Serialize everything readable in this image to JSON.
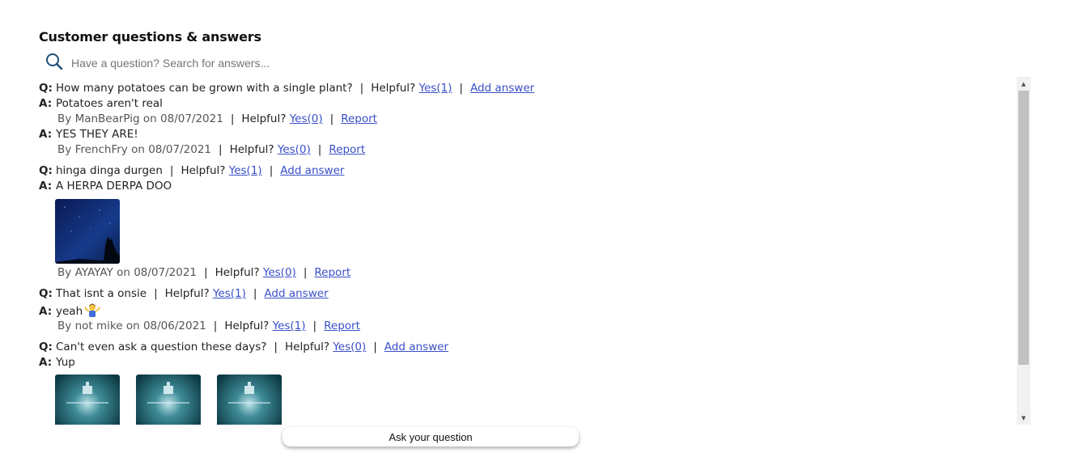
{
  "section": {
    "title": "Customer questions & answers"
  },
  "search": {
    "placeholder": "Have a question? Search for answers..."
  },
  "labels": {
    "q": "Q:",
    "a": "A:",
    "helpful": "Helpful?",
    "sep": "|",
    "by": "By",
    "on": "on"
  },
  "questions": [
    {
      "text": "How many potatoes can be grown with a single plant?",
      "yes": "Yes(1)",
      "add_answer": "Add answer",
      "answers": [
        {
          "text": "Potatoes aren't real",
          "author": "ManBearPig",
          "date": "08/07/2021",
          "yes": "Yes(0)",
          "report": "Report"
        },
        {
          "text": "YES THEY ARE!",
          "author": "FrenchFry",
          "date": "08/07/2021",
          "yes": "Yes(0)",
          "report": "Report"
        }
      ]
    },
    {
      "text": "hinga dinga durgen",
      "yes": "Yes(1)",
      "add_answer": "Add answer",
      "answers": [
        {
          "text": "A HERPA DERPA DOO",
          "author": "AYAYAY",
          "date": "08/07/2021",
          "yes": "Yes(0)",
          "report": "Report"
        }
      ]
    },
    {
      "text": "That isnt a onsie",
      "yes": "Yes(1)",
      "add_answer": "Add answer",
      "answers": [
        {
          "text": "yeah",
          "emoji": "person-shrugging-emoji",
          "author": "not mike",
          "date": "08/06/2021",
          "yes": "Yes(1)",
          "report": "Report"
        }
      ]
    },
    {
      "text": "Can't even ask a question these days?",
      "yes": "Yes(0)",
      "add_answer": "Add answer",
      "answers": [
        {
          "text": "Yup"
        }
      ]
    }
  ],
  "scrollbar": {
    "up": "▲",
    "down": "▼"
  },
  "ask_button": {
    "label": "Ask your question"
  },
  "colors": {
    "link": "#3a50c8",
    "search_icon": "#1f4e79",
    "scroll_thumb": "#c1c1c1"
  },
  "icons": {
    "search": "search-icon"
  }
}
